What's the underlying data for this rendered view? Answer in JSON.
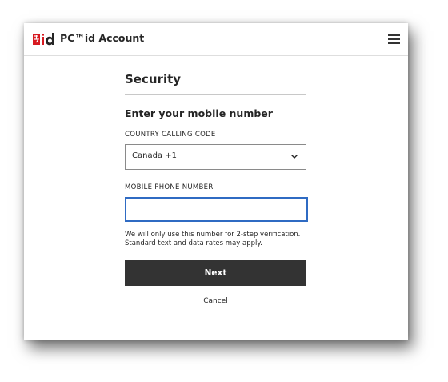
{
  "header": {
    "title": "PC™id Account",
    "logo": {
      "brand_color": "#d71920",
      "icon": "pc-id-logo"
    },
    "menu_icon": "hamburger-menu-icon"
  },
  "main": {
    "page_title": "Security",
    "subtitle": "Enter your mobile number",
    "country_code": {
      "label": "COUNTRY CALLING CODE",
      "selected_value": "Canada +1",
      "icon": "chevron-down-icon"
    },
    "phone": {
      "label": "MOBILE PHONE NUMBER",
      "value": "",
      "focus_color": "#2f6bc3"
    },
    "helper_text": "We will only use this number for 2-step verification. Standard text and data rates may apply.",
    "next_label": "Next",
    "cancel_label": "Cancel"
  },
  "colors": {
    "primary_button": "#333333",
    "text": "#252525"
  }
}
